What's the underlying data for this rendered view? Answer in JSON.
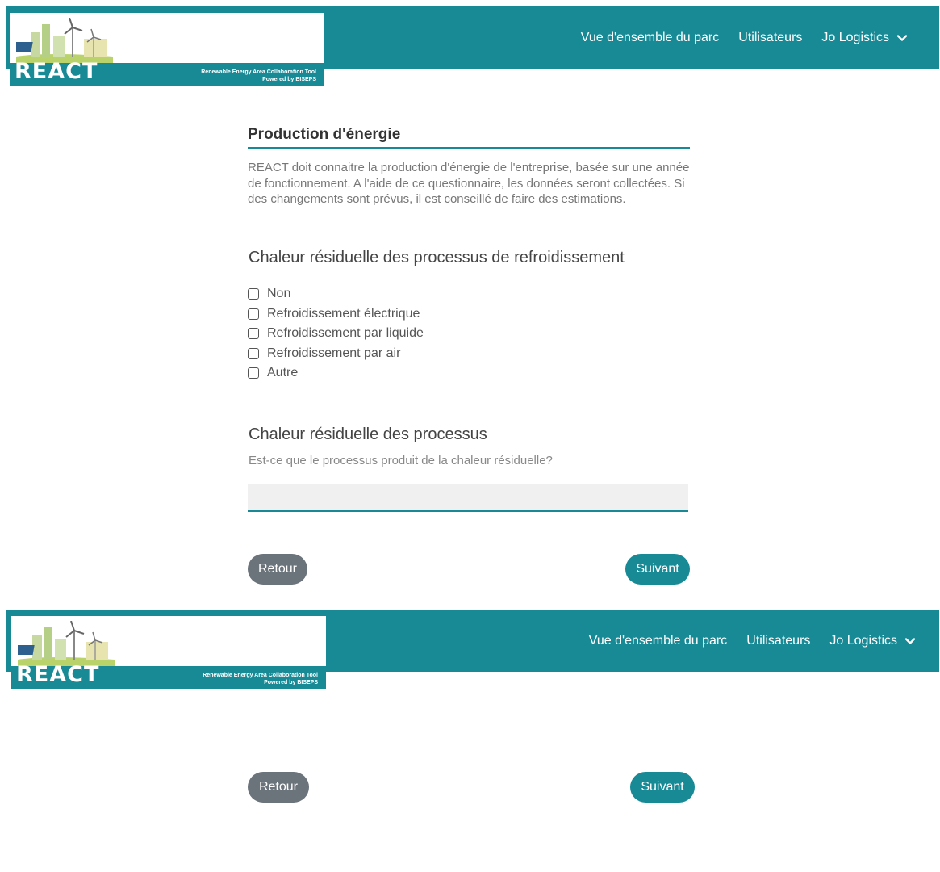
{
  "header": {
    "logo": {
      "word": "REACT",
      "tagline_line1": "Renewable Energy Area Collaboration Tool",
      "tagline_line2": "Powered by BISEPS"
    },
    "nav": {
      "overview": "Vue d'ensemble du parc",
      "users": "Utilisateurs",
      "company": "Jo Logistics"
    }
  },
  "section": {
    "title": "Production d'énergie",
    "intro": "REACT doit connaitre la production d'énergie de l'entreprise, basée sur une année de fonctionnement. A l'aide de ce questionnaire, les données seront collectées. Si des changements sont prévus, il est conseillé de faire des estimations."
  },
  "question1": {
    "title": "Chaleur résiduelle des processus de refroidissement",
    "options": [
      "Non",
      "Refroidissement électrique",
      "Refroidissement par liquide",
      "Refroidissement par air",
      "Autre"
    ]
  },
  "question2": {
    "title": "Chaleur résiduelle des processus",
    "description": "Est-ce que le processus produit de la chaleur résiduelle?",
    "value": ""
  },
  "buttons": {
    "back": "Retour",
    "next": "Suivant"
  },
  "colors": {
    "accent": "#178a96",
    "back_button": "#6b737b"
  }
}
